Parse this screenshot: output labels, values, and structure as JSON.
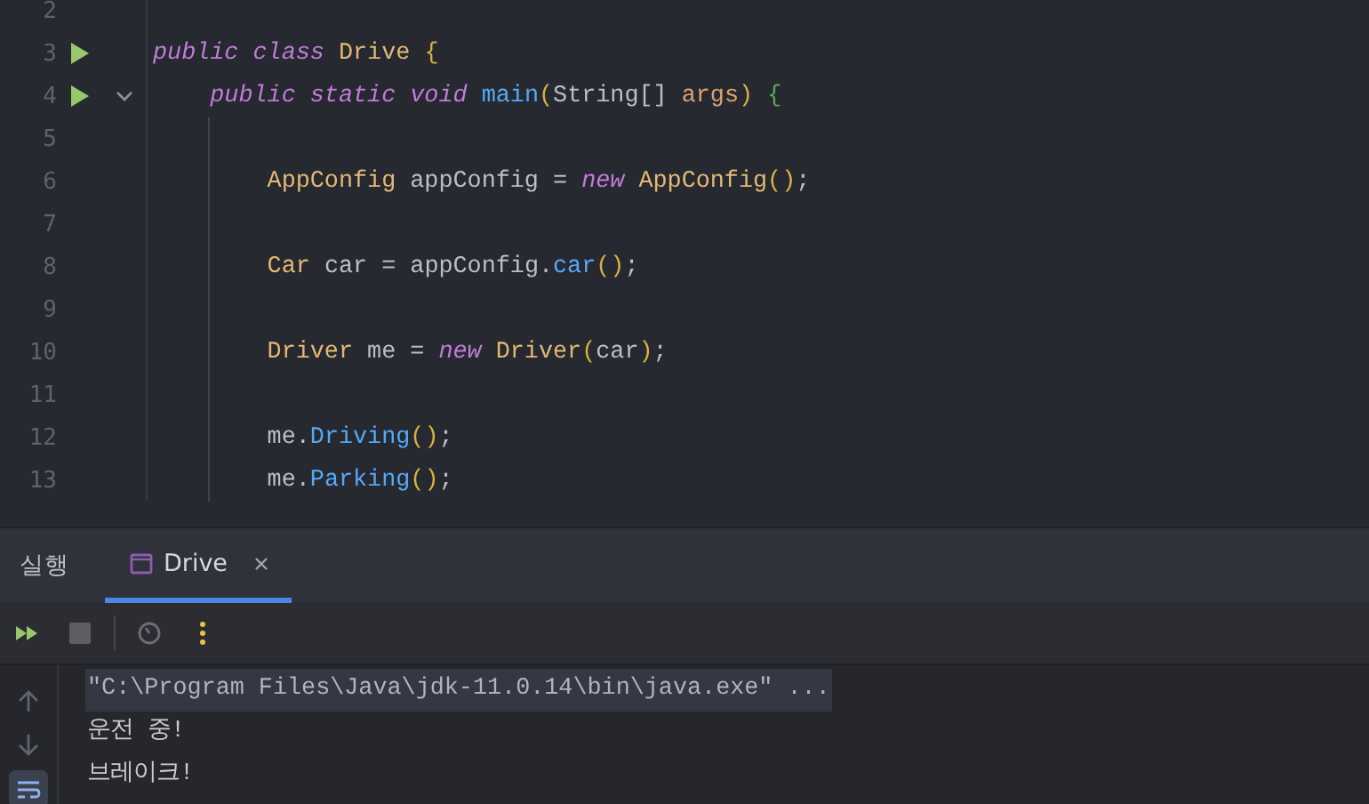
{
  "editor": {
    "lines": [
      {
        "number": "2",
        "run": false,
        "fold": false
      },
      {
        "number": "3",
        "run": true,
        "fold": false,
        "tokens": [
          {
            "text": "public",
            "kind": "kw"
          },
          {
            "text": " class",
            "kind": "kw"
          },
          {
            "text": " Drive ",
            "kind": "type"
          },
          {
            "text": "{",
            "kind": "paren"
          }
        ]
      },
      {
        "number": "4",
        "run": true,
        "fold": true,
        "tokens": [
          {
            "text": "    public static void",
            "kind": "kw"
          },
          {
            "text": " main",
            "kind": "method"
          },
          {
            "text": "(",
            "kind": "paren"
          },
          {
            "text": "String[]",
            "kind": "plain"
          },
          {
            "text": " args",
            "kind": "param"
          },
          {
            "text": ")",
            "kind": "paren"
          },
          {
            "text": " {",
            "kind": "brace"
          }
        ]
      },
      {
        "number": "5",
        "run": false,
        "fold": false
      },
      {
        "number": "6",
        "run": false,
        "fold": false,
        "tokens": [
          {
            "text": "        AppConfig",
            "kind": "type"
          },
          {
            "text": " appConfig = ",
            "kind": "plain"
          },
          {
            "text": "new",
            "kind": "kw"
          },
          {
            "text": " AppConfig",
            "kind": "type"
          },
          {
            "text": "()",
            "kind": "paren"
          },
          {
            "text": ";",
            "kind": "plain"
          }
        ]
      },
      {
        "number": "7",
        "run": false,
        "fold": false
      },
      {
        "number": "8",
        "run": false,
        "fold": false,
        "tokens": [
          {
            "text": "        Car",
            "kind": "type"
          },
          {
            "text": " car = appConfig.",
            "kind": "plain"
          },
          {
            "text": "car",
            "kind": "method"
          },
          {
            "text": "()",
            "kind": "paren"
          },
          {
            "text": ";",
            "kind": "plain"
          }
        ]
      },
      {
        "number": "9",
        "run": false,
        "fold": false
      },
      {
        "number": "10",
        "run": false,
        "fold": false,
        "tokens": [
          {
            "text": "        Driver",
            "kind": "type"
          },
          {
            "text": " me = ",
            "kind": "plain"
          },
          {
            "text": "new",
            "kind": "kw"
          },
          {
            "text": " Driver",
            "kind": "type"
          },
          {
            "text": "(",
            "kind": "paren"
          },
          {
            "text": "car",
            "kind": "plain"
          },
          {
            "text": ")",
            "kind": "paren"
          },
          {
            "text": ";",
            "kind": "plain"
          }
        ]
      },
      {
        "number": "11",
        "run": false,
        "fold": false
      },
      {
        "number": "12",
        "run": false,
        "fold": false,
        "tokens": [
          {
            "text": "        me.",
            "kind": "plain"
          },
          {
            "text": "Driving",
            "kind": "method"
          },
          {
            "text": "()",
            "kind": "paren"
          },
          {
            "text": ";",
            "kind": "plain"
          }
        ]
      },
      {
        "number": "13",
        "run": false,
        "fold": false,
        "tokens": [
          {
            "text": "        me.",
            "kind": "plain"
          },
          {
            "text": "Parking",
            "kind": "method"
          },
          {
            "text": "()",
            "kind": "paren"
          },
          {
            "text": ";",
            "kind": "plain"
          }
        ]
      }
    ]
  },
  "run_panel": {
    "title": "실행",
    "tabs": [
      {
        "label": "Drive",
        "selected": true
      }
    ],
    "soft_wrap": {
      "on": true
    },
    "console": {
      "lines": [
        {
          "text": "\"C:\\Program Files\\Java\\jdk-11.0.14\\bin\\java.exe\" ...",
          "kind": "command"
        },
        {
          "text": "운전 중!",
          "kind": "output"
        },
        {
          "text": "브레이크!",
          "kind": "output"
        }
      ]
    }
  }
}
